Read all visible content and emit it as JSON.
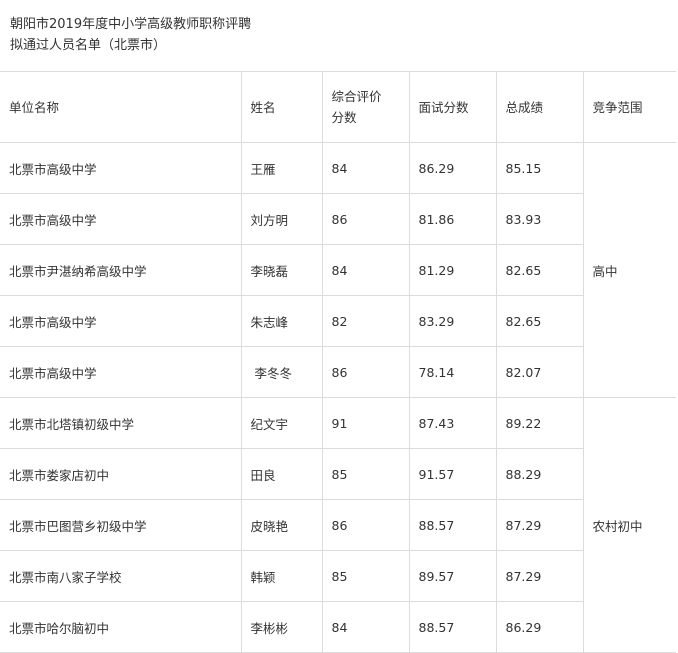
{
  "title": {
    "line1": "朝阳市2019年度中小学高级教师职称评聘",
    "line2": "拟通过人员名单（北票市）"
  },
  "table": {
    "headers": {
      "unit": "单位名称",
      "name": "姓名",
      "eval_line1": "综合评价",
      "eval_line2": "分数",
      "interview": "面试分数",
      "total": "总成绩",
      "scope": "竞争范围"
    },
    "rows": [
      {
        "unit": "北票市高级中学",
        "name": "王雁",
        "eval": "84",
        "interview": "86.29",
        "total": "85.15"
      },
      {
        "unit": "北票市高级中学",
        "name": "刘方明",
        "eval": "86",
        "interview": "81.86",
        "total": "83.93"
      },
      {
        "unit": "北票市尹湛纳希高级中学",
        "name": "李晓磊",
        "eval": "84",
        "interview": "81.29",
        "total": "82.65"
      },
      {
        "unit": "北票市高级中学",
        "name": "朱志峰",
        "eval": "82",
        "interview": "83.29",
        "total": "82.65"
      },
      {
        "unit": "北票市高级中学",
        "name": "李冬冬",
        "eval": "86",
        "interview": "78.14",
        "total": "82.07"
      },
      {
        "unit": "北票市北塔镇初级中学",
        "name": "纪文宇",
        "eval": "91",
        "interview": "87.43",
        "total": "89.22"
      },
      {
        "unit": "北票市娄家店初中",
        "name": "田良",
        "eval": "85",
        "interview": "91.57",
        "total": "88.29"
      },
      {
        "unit": "北票市巴图营乡初级中学",
        "name": "皮晓艳",
        "eval": "86",
        "interview": "88.57",
        "total": "87.29"
      },
      {
        "unit": "北票市南八家子学校",
        "name": "韩颖",
        "eval": "85",
        "interview": "89.57",
        "total": "87.29"
      },
      {
        "unit": "北票市哈尔脑初中",
        "name": "李彬彬",
        "eval": "84",
        "interview": "88.57",
        "total": "86.29"
      }
    ],
    "scopes": {
      "high": "高中",
      "rural": "农村初中"
    }
  }
}
